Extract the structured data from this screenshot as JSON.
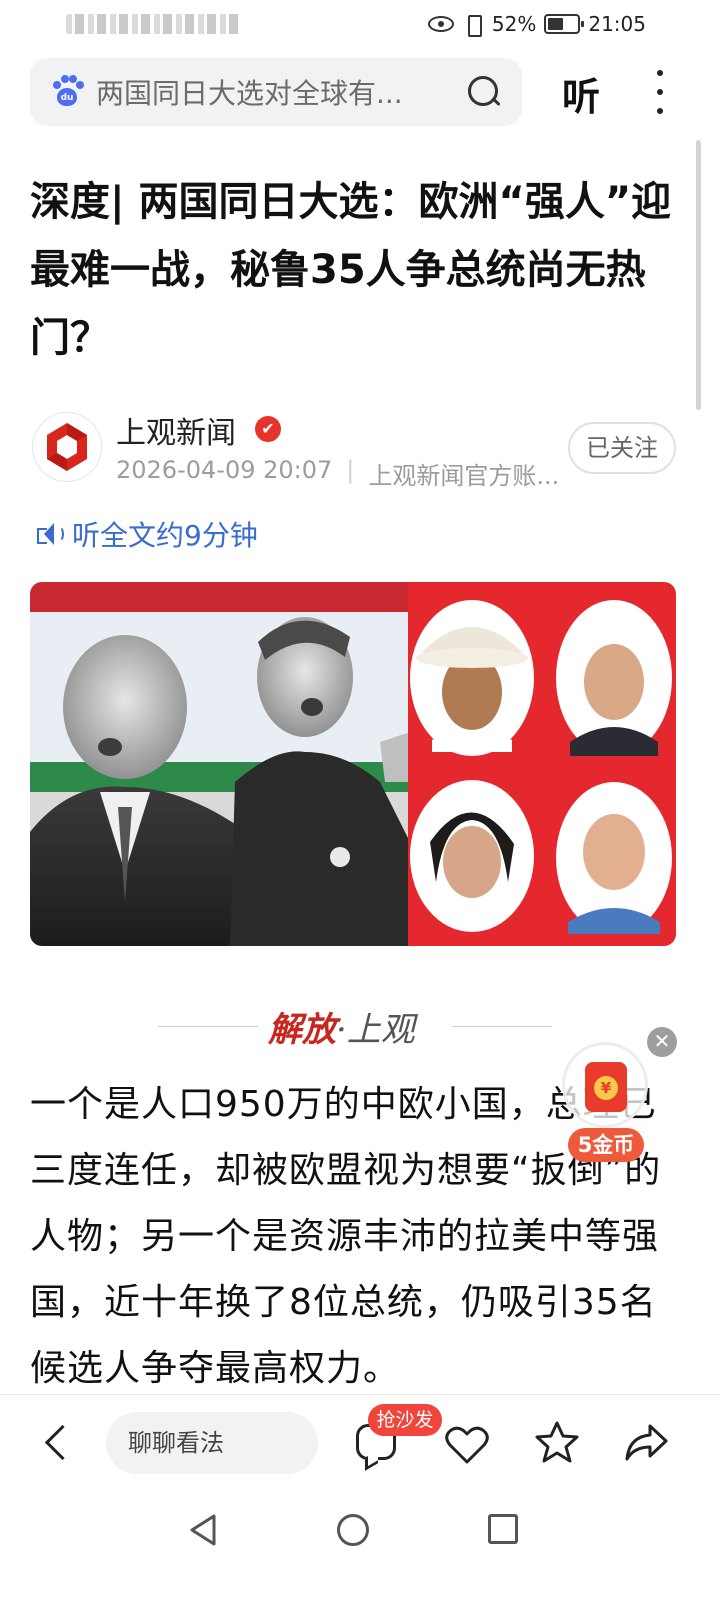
{
  "status_bar": {
    "battery": "52%",
    "time": "21:05"
  },
  "header": {
    "search_text": "两国同日大选对全球有...",
    "listen_label": "听"
  },
  "article": {
    "title": "深度| 两国同日大选：欧洲“强人”迎最难一战，秘鲁35人争总统尚无热门？",
    "author": "上观新闻",
    "date": "2026-04-09 20:07",
    "account_type": "上观新闻官方账...",
    "follow_label": "已关注",
    "listen_full": "听全文约9分钟",
    "source_logo_red": "解放",
    "source_logo_dark": "·上观",
    "body": "一个是人口950万的中欧小国，总理已三度连任，却被欧盟视为想要“扳倒”的人物；另一个是资源丰沛的拉美中等强国，近十年换了8位总统，仍吸引35名候选人争夺最高权力。"
  },
  "floating_reward": {
    "badge": "5金币"
  },
  "bottom_bar": {
    "comment_placeholder": "聊聊看法",
    "sofa_badge": "抢沙发"
  },
  "colors": {
    "accent_blue": "#3a6bd1",
    "brand_red": "#e7342b",
    "background": "#ffffff"
  }
}
